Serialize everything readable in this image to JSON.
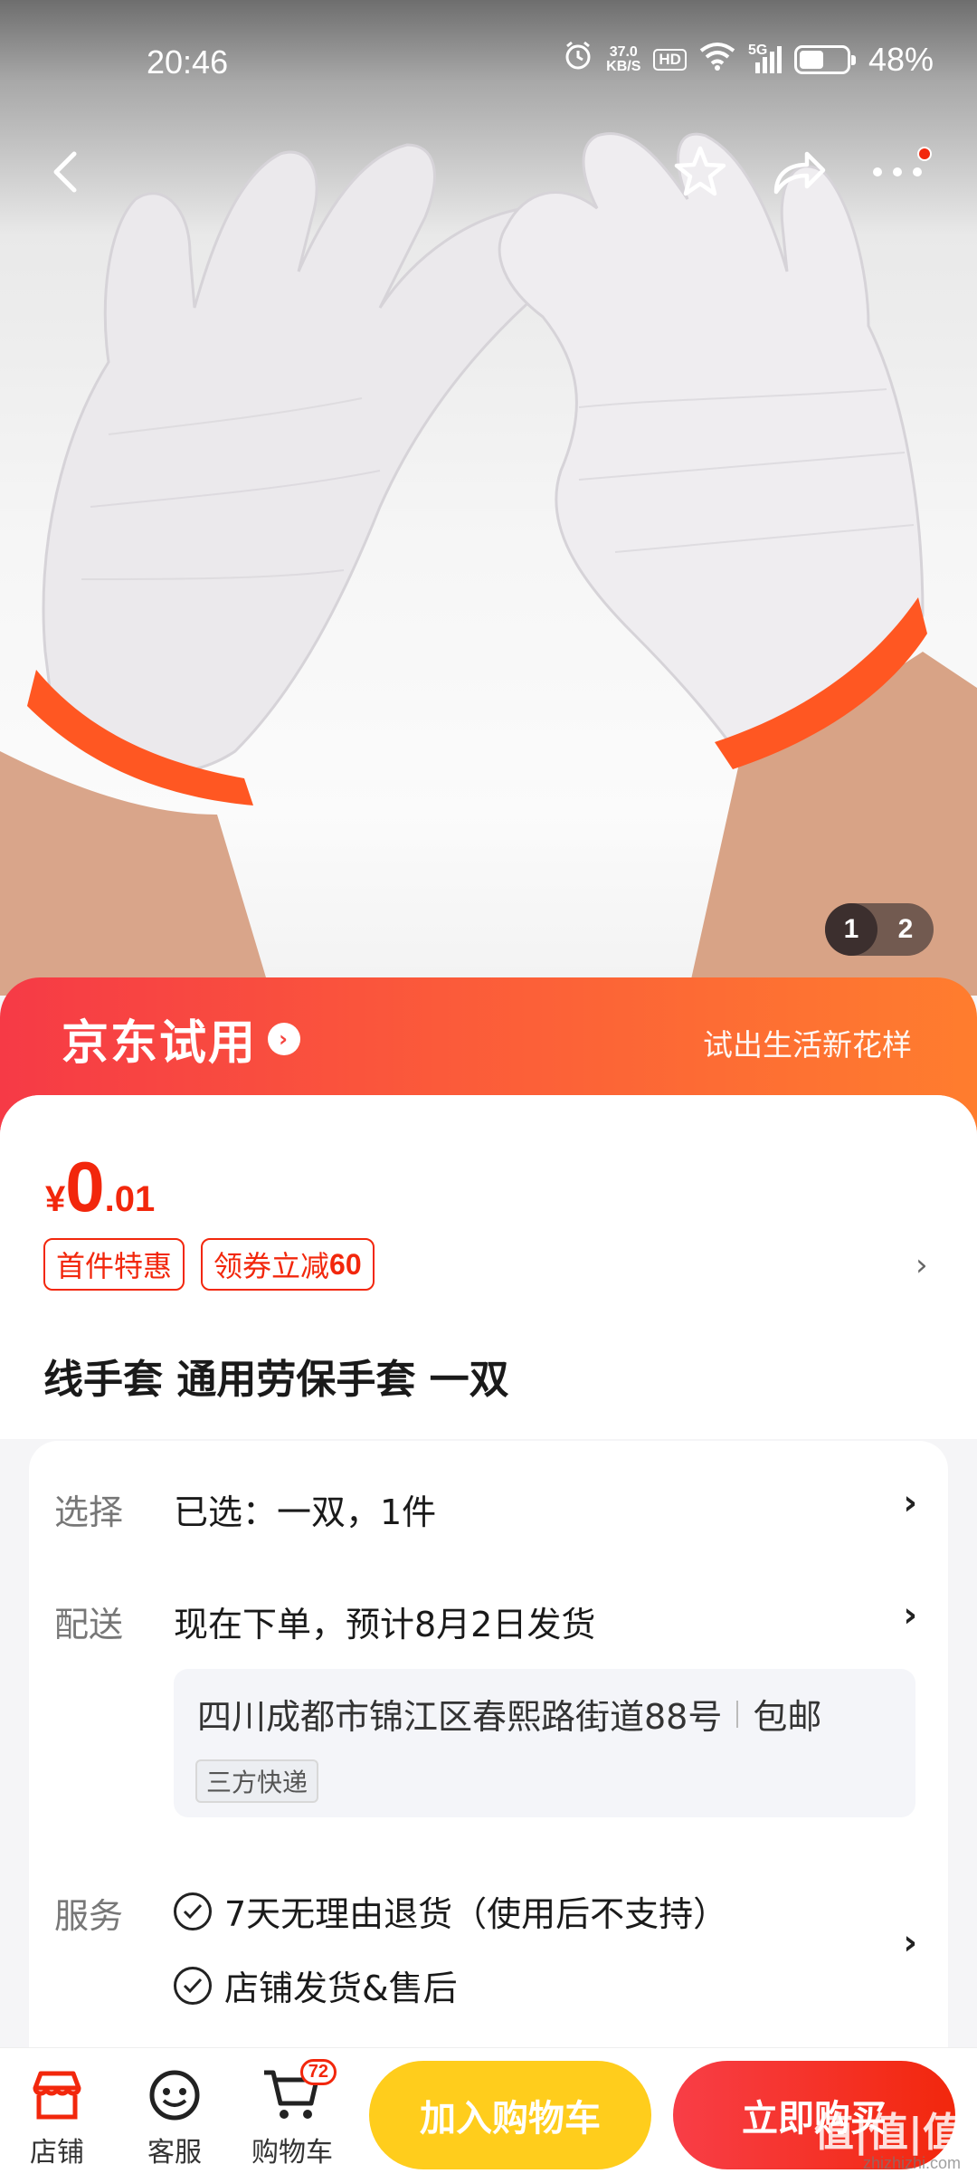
{
  "status_bar": {
    "time": "20:46",
    "net_speed_value": "37.0",
    "net_speed_unit": "KB/S",
    "hd": "HD",
    "network": "5G",
    "battery": "48%"
  },
  "gallery": {
    "current_page": "1",
    "total_pages": "2"
  },
  "trial_banner": {
    "brand": "京东试用",
    "slogan": "试出生活新花样"
  },
  "price": {
    "symbol": "¥",
    "integer": "0",
    "decimal": ".01"
  },
  "tags": {
    "first": "首件特惠",
    "coupon_prefix": "领券立减",
    "coupon_amount": "60"
  },
  "product": {
    "title": "线手套 通用劳保手套 一双"
  },
  "selection": {
    "label": "选择",
    "value": "已选：一双，1件"
  },
  "delivery": {
    "label": "配送",
    "value": "现在下单，预计8月2日发货",
    "address": "四川成都市锦江区春熙路街道88号",
    "shipping": "包邮",
    "courier": "三方快递"
  },
  "service": {
    "label": "服务",
    "items": [
      "7天无理由退货（使用后不支持）",
      "店铺发货&售后"
    ]
  },
  "bottom_bar": {
    "shop": "店铺",
    "service": "客服",
    "cart": "购物车",
    "cart_count": "72",
    "add_to_cart": "加入购物车",
    "buy_now": "立即购买"
  },
  "watermark": {
    "text": "值|值|值",
    "domain": "zhizhizhi.com"
  },
  "colors": {
    "accent": "#f2270c",
    "cart_button": "#ffcd1c"
  }
}
